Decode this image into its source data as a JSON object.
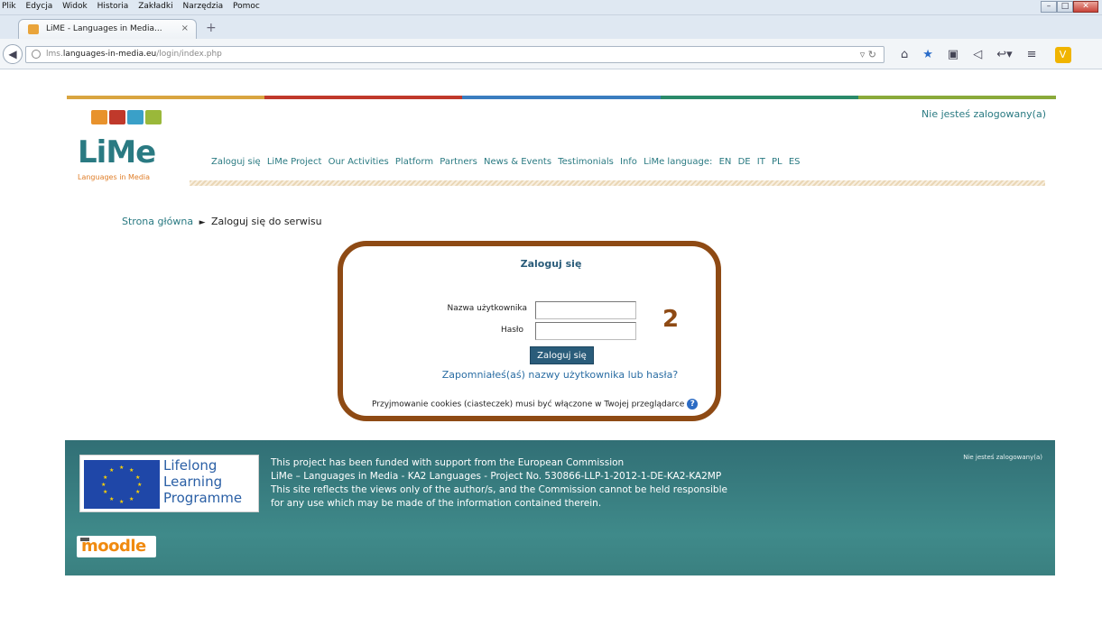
{
  "browser": {
    "menu": [
      "Plik",
      "Edycja",
      "Widok",
      "Historia",
      "Zakładki",
      "Narzędzia",
      "Pomoc"
    ],
    "tab_title": "LiME - Languages in Media...",
    "tab_close": "×",
    "new_tab": "+",
    "url_host_prefix": "lms.",
    "url_host": "languages-in-media.eu",
    "url_path": "/login/index.php"
  },
  "site": {
    "logo_text": "LiMe",
    "logo_sub": "Languages in Media",
    "login_status": "Nie jesteś zalogowany(a)",
    "nav": [
      "Zaloguj się",
      "LiMe Project",
      "Our Activities",
      "Platform",
      "Partners",
      "News & Events",
      "Testimonials",
      "Info",
      "LiMe language:",
      "EN",
      "DE",
      "IT",
      "PL",
      "ES"
    ],
    "colors": {
      "teal": "#2a7a82",
      "brown": "#8e4a14",
      "orange": "#e07f2a"
    }
  },
  "breadcrumb": {
    "home": "Strona główna",
    "separator": "►",
    "current": "Zaloguj się do serwisu"
  },
  "login": {
    "title": "Zaloguj się",
    "username_label": "Nazwa użytkownika",
    "password_label": "Hasło",
    "username_value": "",
    "password_value": "",
    "submit": "Zaloguj się",
    "forgot": "Zapomniałeś(aś) nazwy użytkownika lub hasła?",
    "cookies": "Przyjmowanie cookies (ciasteczek) musi być włączone w Twojej przeglądarce",
    "help_glyph": "?",
    "step_number": "2"
  },
  "footer": {
    "llp_lines": [
      "Lifelong",
      "Learning",
      "Programme"
    ],
    "lines": [
      "This project has been funded with support from the European Commission",
      "LiMe – Languages in Media - KA2 Languages - Project No. 530866-LLP-1-2012-1-DE-KA2-KA2MP",
      "This site reflects the views only of the author/s, and the Commission cannot be held responsible",
      "for any use which may be made of the information contained therein."
    ],
    "login_status": "Nie jesteś zalogowany(a)",
    "moodle": "moodle"
  }
}
